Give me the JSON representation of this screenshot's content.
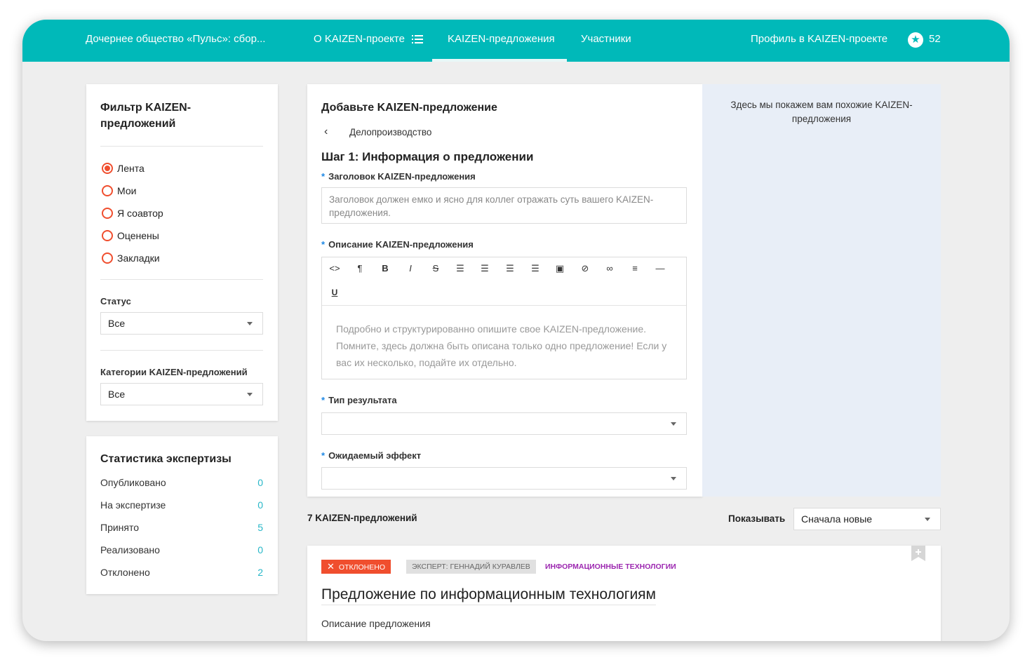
{
  "header": {
    "brand": "Дочернее общество «Пульс»: сбор...",
    "nav": [
      {
        "label": "О KAIZEN-проекте"
      },
      {
        "label": "KAIZEN-предложения"
      },
      {
        "label": "Участники"
      }
    ],
    "profile_link": "Профиль в KAIZEN-проекте",
    "points": "52",
    "accent_color": "#00b9b9"
  },
  "filter": {
    "title_line1": "Фильтр KAIZEN-",
    "title_line2": "предложений",
    "options": [
      {
        "label": "Лента",
        "checked": true
      },
      {
        "label": "Мои",
        "checked": false
      },
      {
        "label": "Я соавтор",
        "checked": false
      },
      {
        "label": "Оценены",
        "checked": false
      },
      {
        "label": "Закладки",
        "checked": false
      }
    ],
    "status_label": "Статус",
    "status_value": "Все",
    "categories_label": "Категории KAIZEN-предложений",
    "categories_value": "Все"
  },
  "stats": {
    "title": "Статистика экспертизы",
    "rows": [
      {
        "label": "Опубликовано",
        "value": "0"
      },
      {
        "label": "На экспертизе",
        "value": "0"
      },
      {
        "label": "Принято",
        "value": "5"
      },
      {
        "label": "Реализовано",
        "value": "0"
      },
      {
        "label": "Отклонено",
        "value": "2"
      }
    ]
  },
  "form": {
    "title": "Добавьте KAIZEN-предложение",
    "back_category": "Делопроизводство",
    "step_title": "Шаг 1: Информация о предложении",
    "title_field_label": "Заголовок KAIZEN-предложения",
    "title_field_placeholder": "Заголовок должен емко и ясно для коллег отражать суть вашего KAIZEN-предложения.",
    "description_label": "Описание KAIZEN-предложения",
    "description_placeholder": "Подробно и структурированно опишите свое KAIZEN-предложение. Помните, здесь должна быть описана только одно предложение! Если у вас их несколько, подайте их отдельно.",
    "result_type_label": "Тип результата",
    "result_type_value": "",
    "effect_label": "Ожидаемый эффект",
    "effect_value": "",
    "toolbar": [
      {
        "icon": "code-icon",
        "glyph": "<>"
      },
      {
        "icon": "paragraph-icon",
        "glyph": "¶"
      },
      {
        "icon": "bold-icon",
        "glyph": "B"
      },
      {
        "icon": "italic-icon",
        "glyph": "I"
      },
      {
        "icon": "strikethrough-icon",
        "glyph": "S"
      },
      {
        "icon": "bulleted-list-icon",
        "glyph": "☰"
      },
      {
        "icon": "numbered-list-icon",
        "glyph": "☰"
      },
      {
        "icon": "outdent-icon",
        "glyph": "☰"
      },
      {
        "icon": "indent-icon",
        "glyph": "☰"
      },
      {
        "icon": "image-icon",
        "glyph": "▣"
      },
      {
        "icon": "attachment-icon",
        "glyph": "⊘"
      },
      {
        "icon": "link-icon",
        "glyph": "∞"
      },
      {
        "icon": "align-icon",
        "glyph": "≡"
      },
      {
        "icon": "horizontal-rule-icon",
        "glyph": "—"
      },
      {
        "icon": "underline-icon",
        "glyph": "U"
      }
    ]
  },
  "similar": {
    "text": "Здесь мы покажем вам похожие KAIZEN-предложения"
  },
  "list": {
    "count_label": "7 KAIZEN-предложений",
    "sort_label": "Показывать",
    "sort_value": "Сначала новые",
    "items": [
      {
        "status": "Отклонено",
        "expert": "Эксперт: Геннадий Куравлев",
        "category": "Информационные технологии",
        "title": "Предложение по информационным технологиям",
        "subtitle": "Описание предложения"
      }
    ],
    "status_color": "#f04e2e",
    "category_color": "#9c27b0"
  }
}
